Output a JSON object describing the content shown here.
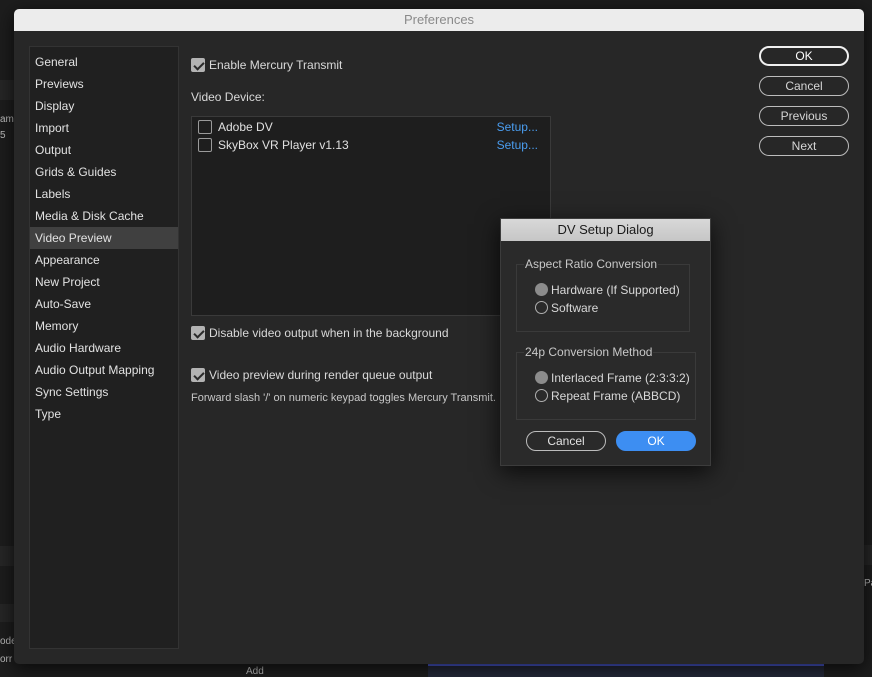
{
  "window": {
    "title": "Preferences"
  },
  "sidebar": {
    "items": [
      {
        "label": "General"
      },
      {
        "label": "Previews"
      },
      {
        "label": "Display"
      },
      {
        "label": "Import"
      },
      {
        "label": "Output"
      },
      {
        "label": "Grids & Guides"
      },
      {
        "label": "Labels"
      },
      {
        "label": "Media & Disk Cache"
      },
      {
        "label": "Video Preview",
        "selected": true
      },
      {
        "label": "Appearance"
      },
      {
        "label": "New Project"
      },
      {
        "label": "Auto-Save"
      },
      {
        "label": "Memory"
      },
      {
        "label": "Audio Hardware"
      },
      {
        "label": "Audio Output Mapping"
      },
      {
        "label": "Sync Settings"
      },
      {
        "label": "Type"
      }
    ]
  },
  "main": {
    "enable_mercury": {
      "label": "Enable Mercury Transmit",
      "checked": true
    },
    "video_device_label": "Video Device:",
    "devices": [
      {
        "name": "Adobe DV",
        "checked": false,
        "setup": "Setup..."
      },
      {
        "name": "SkyBox VR Player v1.13",
        "checked": false,
        "setup": "Setup..."
      }
    ],
    "disable_bg": {
      "label": "Disable video output when in the background",
      "checked": true
    },
    "render_queue": {
      "label": "Video preview during render queue output",
      "checked": true
    },
    "hint": "Forward slash '/' on numeric keypad toggles Mercury Transmit."
  },
  "buttons": {
    "ok": "OK",
    "cancel": "Cancel",
    "previous": "Previous",
    "next": "Next"
  },
  "dv_dialog": {
    "title": "DV Setup Dialog",
    "aspect_group": "Aspect Ratio Conversion",
    "aspect_options": [
      {
        "label": "Hardware (If Supported)",
        "selected": true
      },
      {
        "label": "Software",
        "selected": false
      }
    ],
    "conv_group": "24p Conversion Method",
    "conv_options": [
      {
        "label": "Interlaced Frame (2:3:3:2)",
        "selected": true
      },
      {
        "label": "Repeat Frame (ABBCD)",
        "selected": false
      }
    ],
    "cancel": "Cancel",
    "ok": "OK"
  },
  "background": {
    "left_frag_1": "ame",
    "left_frag_2": "5",
    "left_frag_3": "ode",
    "left_frag_4": "orr",
    "bottom_frag": "Add",
    "right_frag": "Pa"
  }
}
